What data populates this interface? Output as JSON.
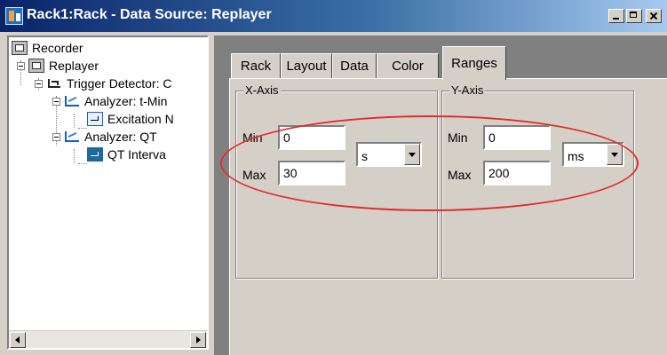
{
  "window": {
    "title": "Rack1:Rack - Data Source: Replayer"
  },
  "tree": {
    "items": [
      {
        "label": "Recorder",
        "icon": "recorder-icon"
      },
      {
        "label": "Replayer",
        "icon": "replayer-icon"
      },
      {
        "label": "Trigger Detector: C",
        "icon": "trigger-detector-icon"
      },
      {
        "label": "Analyzer: t-Min",
        "icon": "analyzer-icon"
      },
      {
        "label": "Excitation N",
        "icon": "excitation-icon"
      },
      {
        "label": "Analyzer: QT",
        "icon": "analyzer-icon"
      },
      {
        "label": "QT Interva",
        "icon": "qt-interval-icon"
      }
    ]
  },
  "tabs": [
    {
      "label": "Rack"
    },
    {
      "label": "Layout"
    },
    {
      "label": "Data"
    },
    {
      "label": "Color"
    },
    {
      "label": "Ranges",
      "active": true
    }
  ],
  "x_axis": {
    "group_label": "X-Axis",
    "min_label": "Min",
    "min_value": "0",
    "max_label": "Max",
    "max_value": "30",
    "unit": "s"
  },
  "y_axis": {
    "group_label": "Y-Axis",
    "min_label": "Min",
    "min_value": "0",
    "max_label": "Max",
    "max_value": "200",
    "unit": "ms"
  },
  "highlight_color": "#e22c2c"
}
